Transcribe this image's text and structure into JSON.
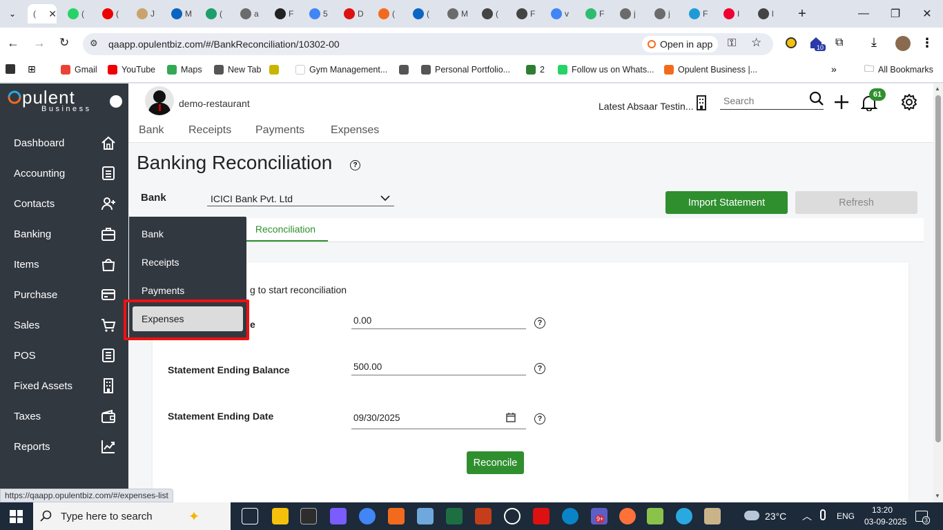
{
  "browser": {
    "tabs": [
      {
        "label": "(",
        "color": "#25d366"
      },
      {
        "label": "(",
        "color": "#e00"
      },
      {
        "label": "J",
        "color": "#c9a36b"
      },
      {
        "label": "M",
        "color": "#0a64c2"
      },
      {
        "label": "(",
        "color": "#1e9e6b"
      },
      {
        "label": "a",
        "color": "#6b6b6b"
      },
      {
        "label": "F",
        "color": "#222"
      },
      {
        "label": "5",
        "color": "#4285f4"
      },
      {
        "label": "D",
        "color": "#d11"
      },
      {
        "label": "(",
        "color": "#f26b1d"
      },
      {
        "label": "(",
        "color": "#0a66c2"
      },
      {
        "label": "M",
        "color": "#6b6b6b"
      },
      {
        "label": "(",
        "color": "#444"
      },
      {
        "label": "F",
        "color": "#444"
      },
      {
        "label": "v",
        "color": "#4285f4"
      },
      {
        "label": "F",
        "color": "#2dbd6e"
      },
      {
        "label": "j",
        "color": "#6b6b6b"
      },
      {
        "label": "j",
        "color": "#6b6b6b"
      },
      {
        "label": "F",
        "color": "#1e9bd7"
      },
      {
        "label": "I",
        "color": "#e03"
      },
      {
        "label": "l",
        "color": "#444"
      }
    ],
    "url": "qaapp.opulentbiz.com/#/BankReconciliation/10302-00",
    "open_in_app": "Open in app",
    "extension_badge": "10",
    "bookmarks": [
      {
        "label": "Gmail",
        "color": "#ea4335"
      },
      {
        "label": "YouTube",
        "color": "#e00"
      },
      {
        "label": "Maps",
        "color": "#34a853"
      },
      {
        "label": "New Tab",
        "color": "#555"
      },
      {
        "label": "",
        "color": "#c9b400"
      },
      {
        "label": "Gym Management...",
        "color": "#ffffff"
      },
      {
        "label": "",
        "color": "#555"
      },
      {
        "label": "Personal Portfolio...",
        "color": "#555"
      },
      {
        "label": "2",
        "color": "#2e7d32"
      },
      {
        "label": "Follow us on Whats...",
        "color": "#25d366"
      },
      {
        "label": "Opulent Business |...",
        "color": "#f26b1d"
      }
    ],
    "all_bookmarks": "All Bookmarks"
  },
  "app": {
    "logo_main": "pulent",
    "logo_sub": "Business",
    "company": "demo-restaurant",
    "org": "Latest Absaar Testin...",
    "search_placeholder": "Search",
    "notif_count": "61",
    "topnav": [
      "Bank",
      "Receipts",
      "Payments",
      "Expenses"
    ],
    "sidebar": [
      {
        "label": "Dashboard",
        "icon": "home-icon"
      },
      {
        "label": "Accounting",
        "icon": "ledger-icon"
      },
      {
        "label": "Contacts",
        "icon": "add-user-icon"
      },
      {
        "label": "Banking",
        "icon": "briefcase-icon"
      },
      {
        "label": "Items",
        "icon": "shopping-bag-icon"
      },
      {
        "label": "Purchase",
        "icon": "card-icon"
      },
      {
        "label": "Sales",
        "icon": "cart-icon"
      },
      {
        "label": "POS",
        "icon": "pos-icon"
      },
      {
        "label": "Fixed Assets",
        "icon": "building-icon"
      },
      {
        "label": "Taxes",
        "icon": "wallet-icon"
      },
      {
        "label": "Reports",
        "icon": "chart-icon"
      }
    ],
    "page_title": "Banking Reconciliation",
    "bank_label": "Bank",
    "bank_value": "ICICI Bank Pvt. Ltd",
    "import_btn": "Import Statement",
    "refresh_btn": "Refresh",
    "tab_reconciliation": "Reconciliation",
    "instruction": "g to start reconciliation",
    "field_opening_label_tail": "e",
    "field_opening_value": "0.00",
    "field_ending_balance_label": "Statement Ending Balance",
    "field_ending_balance_value": "500.00",
    "field_ending_date_label": "Statement Ending Date",
    "field_ending_date_value": "09/30/2025",
    "reconcile_btn": "Reconcile",
    "popup": [
      "Bank",
      "Receipts",
      "Payments",
      "Expenses"
    ],
    "status_url": "https://qaapp.opulentbiz.com/#/expenses-list"
  },
  "taskbar": {
    "search_placeholder": "Type here to search",
    "teams_badge": "9+",
    "weather": "23°C",
    "lang": "ENG",
    "time": "13:20",
    "date": "03-09-2025",
    "notif": "3"
  }
}
